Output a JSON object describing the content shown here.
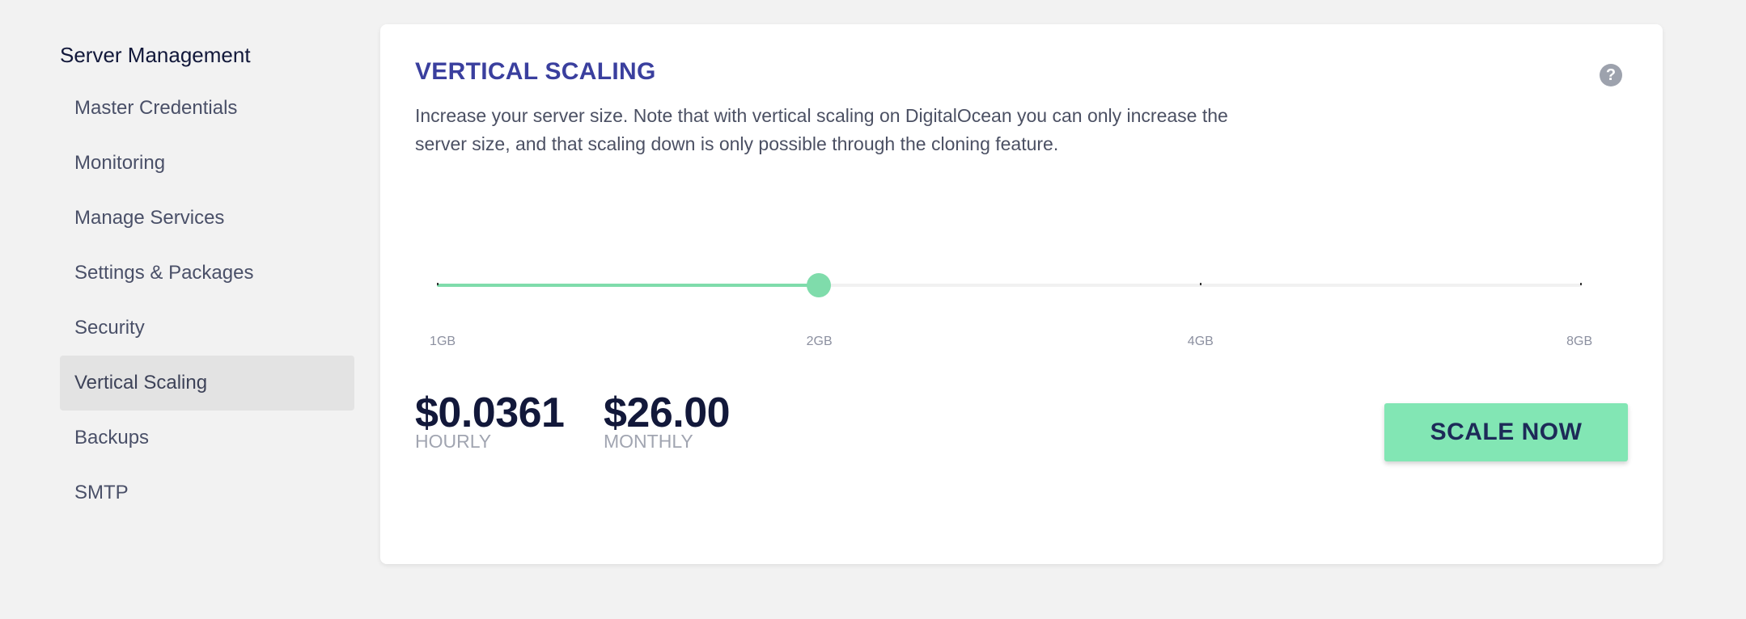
{
  "sidebar": {
    "title": "Server Management",
    "items": [
      {
        "label": "Master Credentials"
      },
      {
        "label": "Monitoring"
      },
      {
        "label": "Manage Services"
      },
      {
        "label": "Settings & Packages"
      },
      {
        "label": "Security"
      },
      {
        "label": "Vertical Scaling",
        "active": true
      },
      {
        "label": "Backups"
      },
      {
        "label": "SMTP"
      }
    ]
  },
  "panel": {
    "title": "VERTICAL SCALING",
    "help_icon": "?",
    "description": "Increase your server size. Note that with vertical scaling on DigitalOcean you can only increase the server size, and that scaling down is only possible through the cloning feature.",
    "slider": {
      "options": [
        "1GB",
        "2GB",
        "4GB",
        "8GB"
      ],
      "selected": "2GB",
      "selected_index": 1
    },
    "pricing": {
      "hourly_value": "$0.0361",
      "hourly_label": "HOURLY",
      "monthly_value": "$26.00",
      "monthly_label": "MONTHLY"
    },
    "scale_button_label": "SCALE NOW"
  },
  "colors": {
    "accent_green": "#82e6b4",
    "title_blue": "#3a3f9e",
    "dark_navy": "#12183a",
    "background": "#f2f2f2"
  },
  "icons": {
    "help": "question-circle-icon"
  }
}
